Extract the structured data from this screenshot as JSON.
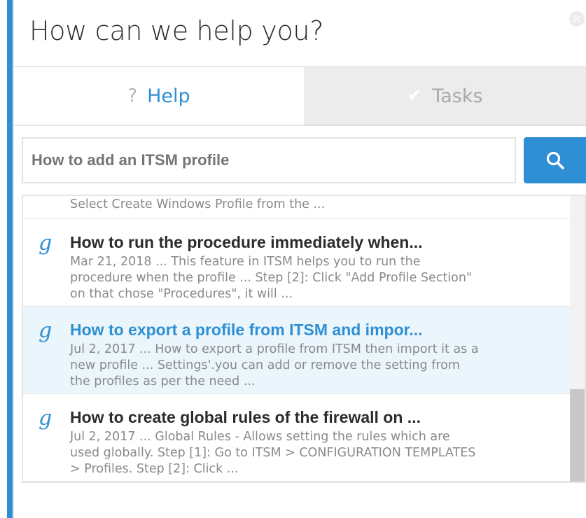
{
  "header": {
    "title": "How can we help you?",
    "close_glyph": "×"
  },
  "tabs": [
    {
      "label": "Help",
      "icon": "question-icon",
      "glyph": "?",
      "active": true
    },
    {
      "label": "Tasks",
      "icon": "check-icon",
      "glyph": "✔",
      "active": false
    }
  ],
  "search": {
    "value": "How to add an ITSM profile",
    "placeholder": "",
    "button_icon": "search-icon"
  },
  "results": {
    "partial_snippet": "Select Create Windows Profile from the ...",
    "items": [
      {
        "title": "How to run the procedure immediately when...",
        "snippet": "Mar 21, 2018 ... This feature in ITSM helps you to run the procedure when the profile ... Step [2]: Click \"Add Profile Section\" on that chose \"Procedures\", it will ...",
        "highlighted": false
      },
      {
        "title": "How to export a profile from ITSM and impor...",
        "snippet": "Jul 2, 2017 ... How to export a profile from ITSM then import it as a new profile ... Settings'.you can add or remove the setting from the profiles as per the need ...",
        "highlighted": true
      },
      {
        "title": "How to create global rules of the firewall on ...",
        "snippet": "Jul 2, 2017 ... Global Rules - Allows setting the rules which are used globally. Step [1]: Go to ITSM > CONFIGURATION TEMPLATES > Profiles. Step [2]: Click ...",
        "highlighted": false
      }
    ],
    "result_icon_glyph": "g"
  },
  "colors": {
    "accent": "#2e8fd4",
    "highlight_row": "#eaf6fb",
    "tab_inactive": "#ececec"
  }
}
